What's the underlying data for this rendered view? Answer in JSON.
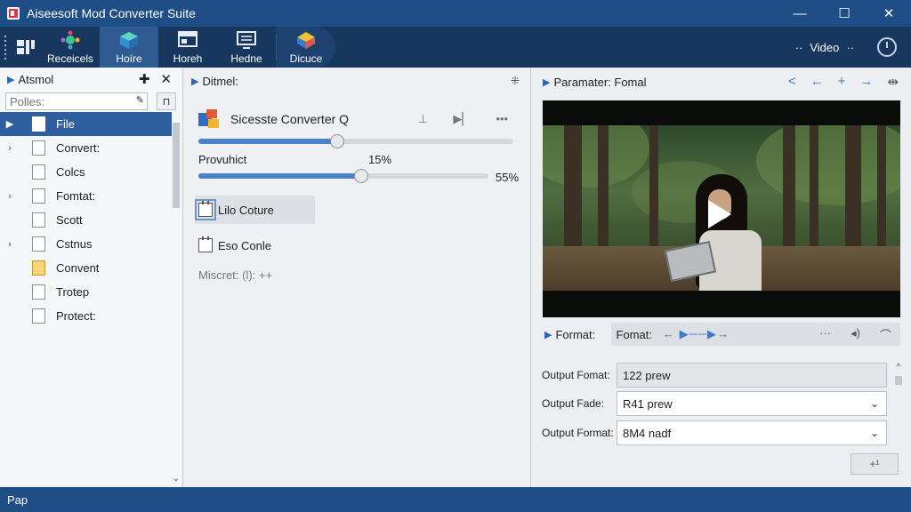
{
  "app": {
    "title": "Aiseesoft Mod Converter Suite"
  },
  "window_controls": {
    "minimize": "—",
    "maximize": "☐",
    "close": "✕"
  },
  "toolbar": {
    "items": [
      {
        "label": "Receicels",
        "icon": "puzzle-icon"
      },
      {
        "label": "Hoíre",
        "icon": "home-cube-icon"
      },
      {
        "label": "Horeh",
        "icon": "window-icon"
      },
      {
        "label": "Hedne",
        "icon": "monitor-icon"
      },
      {
        "label": "Dicuce",
        "icon": "cube-icon"
      }
    ],
    "active_index": 1,
    "video_dropdown": "Video",
    "video_prefix": "··",
    "video_suffix": "··"
  },
  "left_panel": {
    "title": "Atsmol",
    "filter_placeholder": "Polles:",
    "tree": [
      {
        "label": "File",
        "expandable": true,
        "selected": true,
        "folder_color": "white"
      },
      {
        "label": "Convert:",
        "expandable": true,
        "selected": false,
        "folder_color": "white"
      },
      {
        "label": "Colcs",
        "expandable": false,
        "selected": false,
        "folder_color": "white"
      },
      {
        "label": "Fomtat:",
        "expandable": true,
        "selected": false,
        "folder_color": "white"
      },
      {
        "label": "Scott",
        "expandable": false,
        "selected": false,
        "folder_color": "white"
      },
      {
        "label": "Cstnus",
        "expandable": true,
        "selected": false,
        "folder_color": "white"
      },
      {
        "label": "Convent",
        "expandable": false,
        "selected": false,
        "folder_color": "yellow"
      },
      {
        "label": "Trotep",
        "expandable": false,
        "selected": false,
        "folder_color": "white"
      },
      {
        "label": "Protect:",
        "expandable": false,
        "selected": false,
        "folder_color": "white"
      }
    ]
  },
  "middle_panel": {
    "title": "Ditmel:",
    "converter_title": "Sicesste Converter Q",
    "slider1_value": 0.44,
    "progress_label": "Provuhict",
    "progress_pct": "15%",
    "slider2_value": 0.56,
    "progress_end": "55%",
    "buttons": [
      {
        "label": "Lilo Coture"
      },
      {
        "label": "Eso Conle"
      }
    ],
    "meta": "Miscret: (l): ++"
  },
  "right_panel": {
    "title": "Paramater: Fomal",
    "format_toggle": "Format:",
    "format_strip_label": "Fomat:",
    "fields": [
      {
        "label": "Output Fomat:",
        "value": "122 prew",
        "dropdown": false
      },
      {
        "label": "Output Fade:",
        "value": "R41 prew",
        "dropdown": true
      },
      {
        "label": "Output Format:",
        "value": "8M4 nadf",
        "dropdown": true
      }
    ],
    "add_button": "+¹"
  },
  "status": {
    "text": "Pap"
  },
  "colors": {
    "title_bar": "#1f4d86",
    "toolbar": "#17375f",
    "accent": "#2f5f9e",
    "link": "#3a7bd0"
  }
}
